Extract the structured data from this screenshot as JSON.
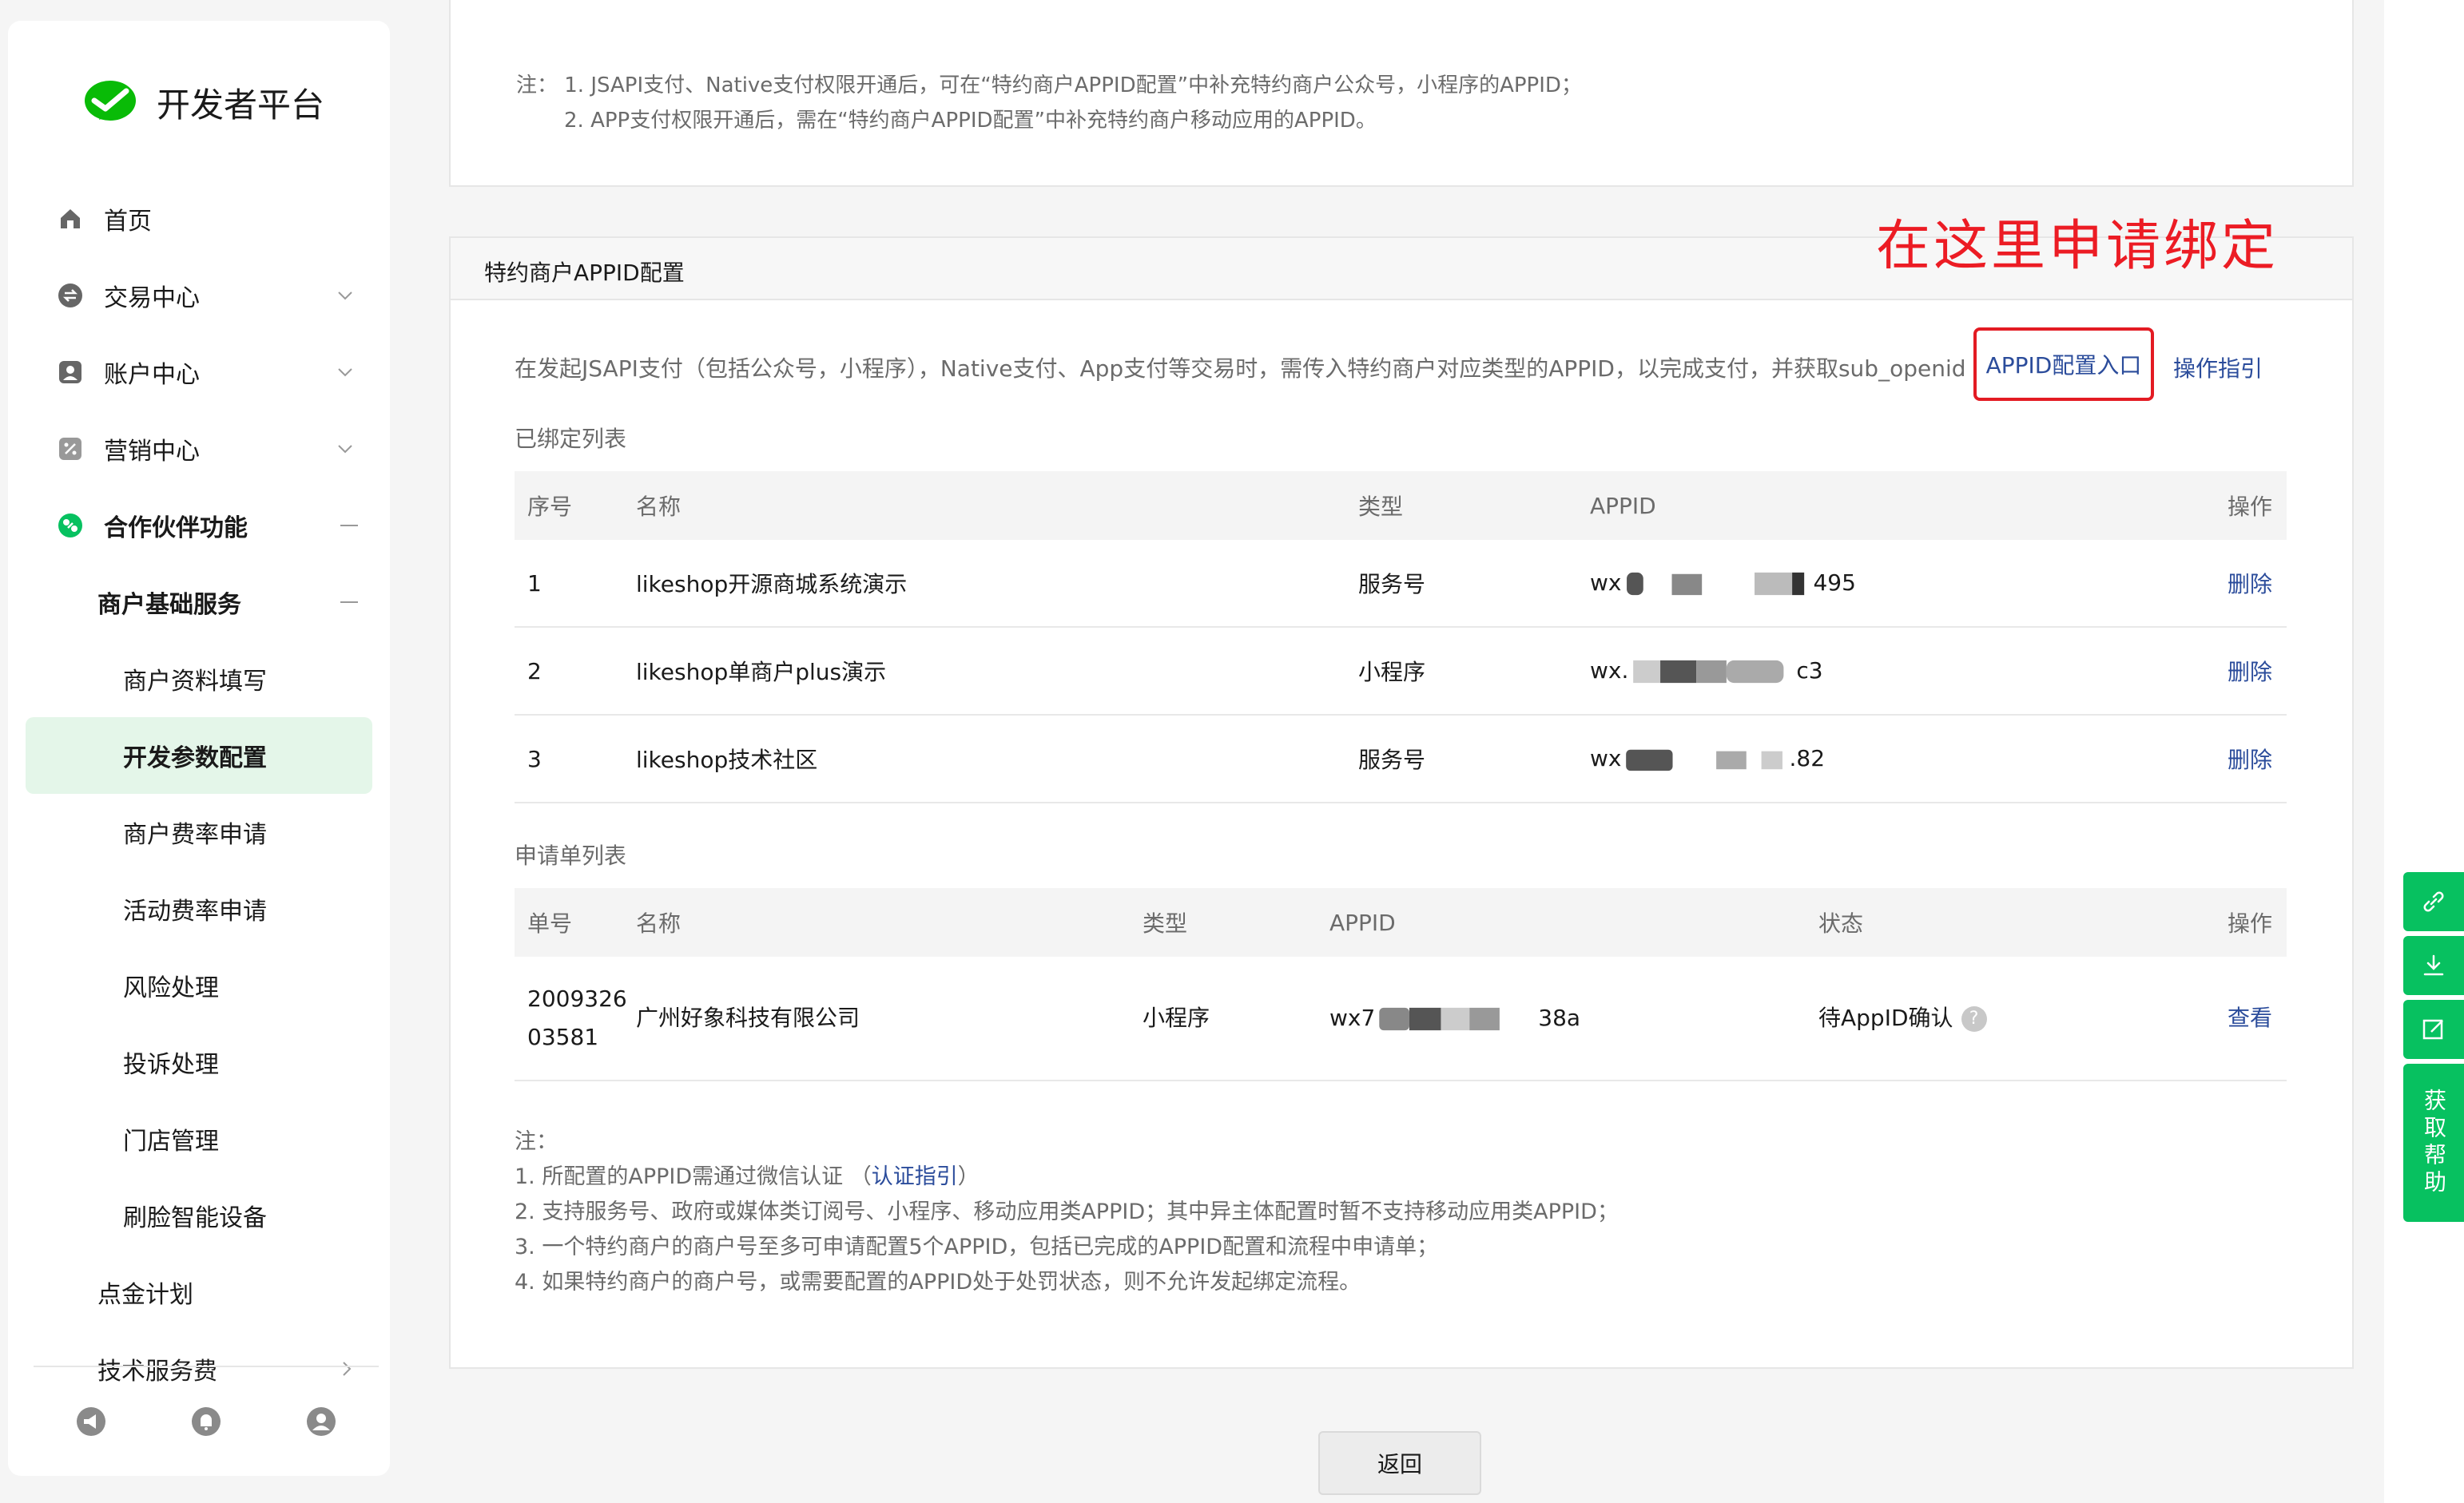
{
  "brand": {
    "title": "开发者平台"
  },
  "nav": {
    "home": "首页",
    "trade": "交易中心",
    "account": "账户中心",
    "marketing": "营销中心",
    "partner": "合作伙伴功能",
    "merchant_basic": "商户基础服务",
    "merchant_info": "商户资料填写",
    "dev_params": "开发参数配置",
    "merchant_rate": "商户费率申请",
    "activity_rate": "活动费率申请",
    "risk": "风险处理",
    "complaint": "投诉处理",
    "store": "门店管理",
    "face_device": "刷脸智能设备",
    "dianjin": "点金计划",
    "tech_fee": "技术服务费"
  },
  "top_notes": {
    "line1": "注：  1. JSAPI支付、Native支付权限开通后，可在“特约商户APPID配置”中补充特约商户公众号，小程序的APPID；",
    "line2": "2. APP支付权限开通后，需在“特约商户APPID配置”中补充特约商户移动应用的APPID。"
  },
  "config": {
    "title": "特约商户APPID配置",
    "annotation": "在这里申请绑定",
    "description": "在发起JSAPI支付（包括公众号，小程序），Native支付、App支付等交易时，需传入特约商户对应类型的APPID，以完成支付，并获取sub_openid",
    "entry_link": "APPID配置入口",
    "guide_link": "操作指引",
    "bound_title": "已绑定列表",
    "bound_headers": {
      "seq": "序号",
      "name": "名称",
      "type": "类型",
      "appid": "APPID",
      "op": "操作"
    },
    "bound_rows": [
      {
        "seq": "1",
        "name": "likeshop开源商城系统演示",
        "type": "服务号",
        "appid_prefix": "wx",
        "appid_suffix": "495",
        "op": "删除"
      },
      {
        "seq": "2",
        "name": "likeshop单商户plus演示",
        "type": "小程序",
        "appid_prefix": "wx.",
        "appid_suffix": "c3",
        "op": "删除"
      },
      {
        "seq": "3",
        "name": "likeshop技术社区",
        "type": "服务号",
        "appid_prefix": "wx",
        "appid_suffix": ".82",
        "op": "删除"
      }
    ],
    "apply_title": "申请单列表",
    "apply_headers": {
      "no": "单号",
      "name": "名称",
      "type": "类型",
      "appid": "APPID",
      "status": "状态",
      "op": "操作"
    },
    "apply_rows": [
      {
        "no_line1": "2009326",
        "no_line2": "03581",
        "name": "广州好象科技有限公司",
        "type": "小程序",
        "appid_prefix": "wx7",
        "appid_suffix": "38a",
        "status": "待AppID确认",
        "op": "查看"
      }
    ],
    "notes": {
      "head": "注：",
      "n1": "1. 所配置的APPID需通过微信认证 （",
      "n1_link": "认证指引",
      "n1_tail": "）",
      "n2": "2. 支持服务号、政府或媒体类订阅号、小程序、移动应用类APPID；其中异主体配置时暂不支持移动应用类APPID；",
      "n3": "3. 一个特约商户的商户号至多可申请配置5个APPID，包括已完成的APPID配置和流程中申请单；",
      "n4": "4. 如果特约商户的商户号，或需要配置的APPID处于处罚状态，则不允许发起绑定流程。"
    }
  },
  "back_button": "返回",
  "float_help": "获取帮助",
  "colors": {
    "brand_green": "#07c160",
    "link_blue": "#2b4c9b",
    "annotation_red": "#ec1c24",
    "selected_bg": "#e4f6e9"
  }
}
